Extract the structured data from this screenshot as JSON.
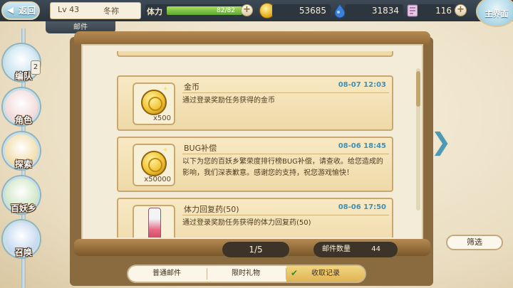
{
  "header": {
    "back_label": "返回",
    "level": "Lv 43",
    "player_name": "冬祢",
    "section_tab": "邮件",
    "stamina_label": "体力",
    "stamina_value": "82/82",
    "stamina_fraction": 1.0,
    "gold": "53685",
    "gems": "31834",
    "tickets": "116",
    "main_button": "主界面"
  },
  "sidebar": {
    "items": [
      {
        "label": "编队",
        "badge": "2",
        "color": "#c7e2f0"
      },
      {
        "label": "角色",
        "color": "#f2d8d8"
      },
      {
        "label": "探索",
        "color": "#f2dca8"
      },
      {
        "label": "百妖乡",
        "color": "#cfe6c4"
      },
      {
        "label": "召唤",
        "color": "#c4d8f0"
      }
    ]
  },
  "mails": [
    {
      "title": "金币",
      "date": "08-07 12:03",
      "body": "通过登录奖励任务获得的金币",
      "qty": "x500",
      "item": "gold"
    },
    {
      "title": "BUG补偿",
      "date": "08-06 18:45",
      "body": "以下为您的百妖乡繁荣度排行榜BUG补偿，请查收。给您造成的影响，我们深表歉意。感谢您的支持，祝您游戏愉快！",
      "qty": "x50000",
      "item": "gold"
    },
    {
      "title": "体力回复药(50)",
      "date": "08-06 17:50",
      "body": "通过登录奖励任务获得的体力回复药(50)",
      "qty": "",
      "item": "potion"
    }
  ],
  "footer": {
    "page": "1/5",
    "mail_count_label": "邮件数量",
    "mail_count": "44",
    "filter_label": "筛选",
    "tabs": [
      "普通邮件",
      "限时礼物",
      "收取记录"
    ]
  }
}
